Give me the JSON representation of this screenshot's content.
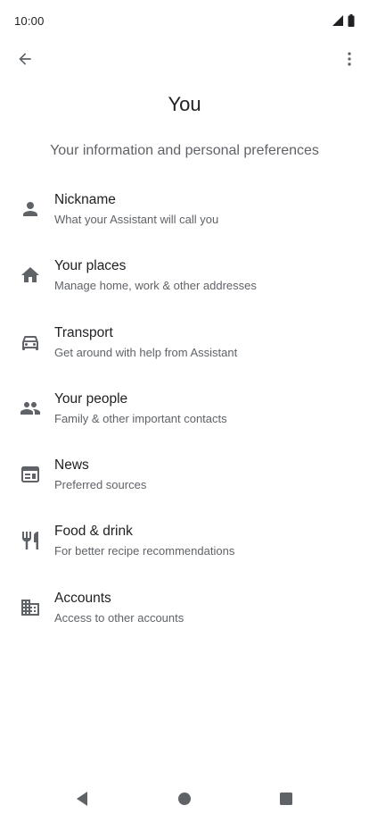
{
  "status_bar": {
    "time": "10:00",
    "icons": [
      "cell-signal-icon",
      "battery-icon"
    ]
  },
  "toolbar": {
    "back_icon": "arrow-back-icon",
    "more_icon": "more-vert-icon"
  },
  "page": {
    "title": "You",
    "subtitle": "Your information and personal preferences"
  },
  "items": [
    {
      "icon": "person-icon",
      "title": "Nickname",
      "description": "What your Assistant will call you"
    },
    {
      "icon": "home-icon",
      "title": "Your places",
      "description": "Manage home, work & other addresses"
    },
    {
      "icon": "car-icon",
      "title": "Transport",
      "description": "Get around with help from Assistant"
    },
    {
      "icon": "people-icon",
      "title": "Your people",
      "description": "Family & other important contacts"
    },
    {
      "icon": "news-icon",
      "title": "News",
      "description": "Preferred sources"
    },
    {
      "icon": "restaurant-icon",
      "title": "Food & drink",
      "description": "For better recipe recommendations"
    },
    {
      "icon": "business-icon",
      "title": "Accounts",
      "description": "Access to other accounts"
    }
  ],
  "nav_bar": {
    "back_icon": "nav-back-icon",
    "home_icon": "nav-home-icon",
    "recents_icon": "nav-recents-icon"
  },
  "colors": {
    "background": "#ffffff",
    "primary_text": "#202124",
    "secondary_text": "#5f6368",
    "icon": "#5f6368",
    "nav_icon": "#5f6368"
  }
}
